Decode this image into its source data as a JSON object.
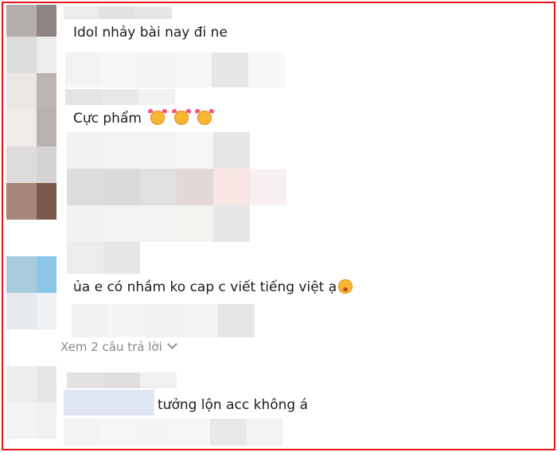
{
  "comments": [
    {
      "text": "Idol nhảy bài nay đi ne"
    },
    {
      "text": "Cực phẩm",
      "emoji": [
        "smiling-face-with-hearts-icon",
        "smiling-face-with-hearts-icon",
        "smiling-face-with-hearts-icon"
      ]
    },
    {
      "text": "ủa e có nhầm ko cap c viết tiếng việt ạ",
      "emoji": [
        "flushed-face-icon"
      ]
    },
    {
      "text": "tưởng lộn acc không á"
    }
  ],
  "view_replies_label": "Xem 2 câu trả lời",
  "colors": {
    "border": "#e8161c",
    "muted": "#8a8a8a",
    "text": "#1c1c1c"
  }
}
